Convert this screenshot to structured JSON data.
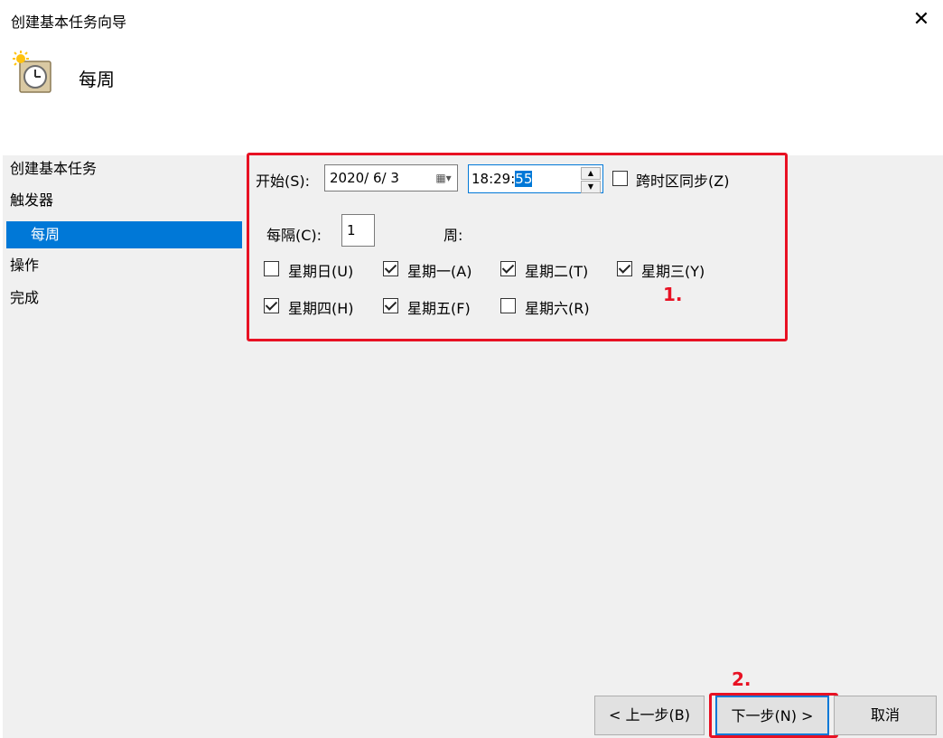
{
  "window": {
    "title": "创建基本任务向导"
  },
  "header": {
    "title": "每周"
  },
  "nav": {
    "items": [
      "创建基本任务",
      "触发器",
      "每周",
      "操作",
      "完成"
    ]
  },
  "trigger": {
    "start_label": "开始(S):",
    "date_value": "2020/  6/  3",
    "time_prefix": "18:29:",
    "time_selected": "55",
    "sync_label": "跨时区同步(Z)",
    "sync_checked": false,
    "interval_label": "每隔(C):",
    "interval_value": "1",
    "interval_unit": "周:"
  },
  "days": [
    {
      "label": "星期日(U)",
      "checked": false
    },
    {
      "label": "星期一(A)",
      "checked": true
    },
    {
      "label": "星期二(T)",
      "checked": true
    },
    {
      "label": "星期三(Y)",
      "checked": true
    },
    {
      "label": "星期四(H)",
      "checked": true
    },
    {
      "label": "星期五(F)",
      "checked": true
    },
    {
      "label": "星期六(R)",
      "checked": false
    }
  ],
  "annotations": {
    "step1": "1.",
    "step2": "2."
  },
  "buttons": {
    "back": "< 上一步(B)",
    "next": "下一步(N) >",
    "cancel": "取消"
  },
  "colors": {
    "accent": "#0078d7",
    "annotation": "#e81123",
    "panel": "#f0f0f0"
  }
}
